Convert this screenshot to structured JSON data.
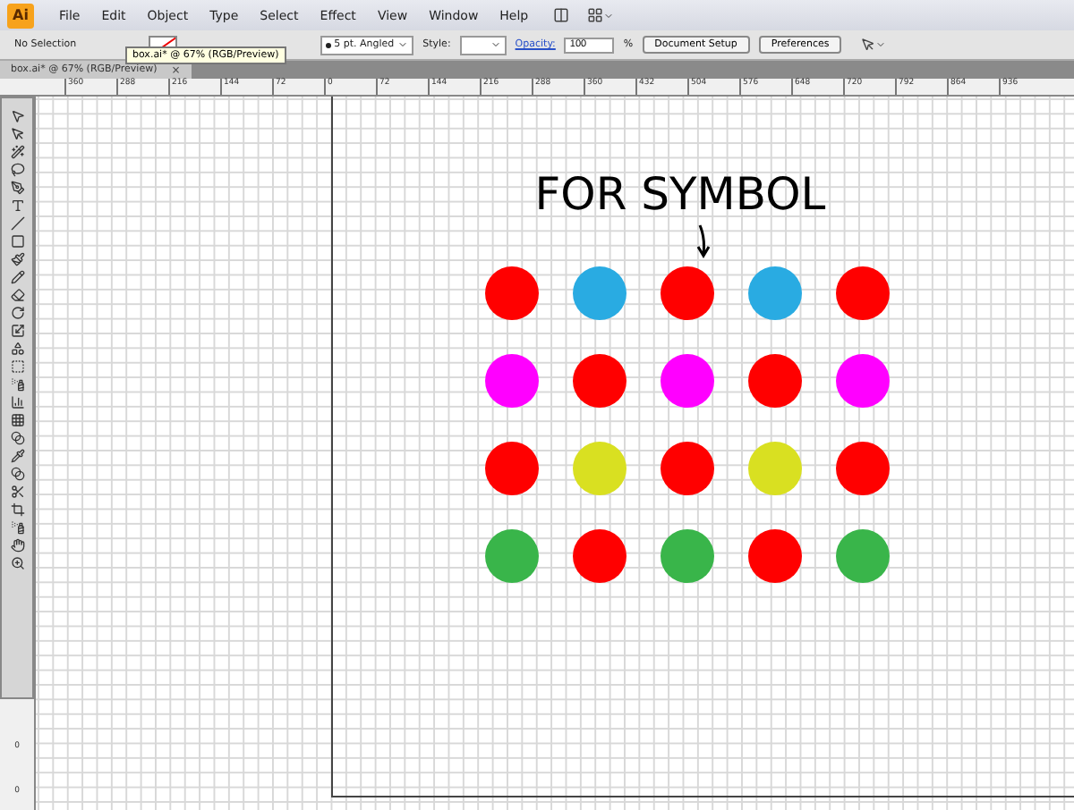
{
  "app": {
    "logo": "Ai"
  },
  "menu": [
    "File",
    "Edit",
    "Object",
    "Type",
    "Select",
    "Effect",
    "View",
    "Window",
    "Help"
  ],
  "control_bar": {
    "selection": "No Selection",
    "brush": "5 pt. Angled",
    "style_label": "Style:",
    "opacity_label": "Opacity:",
    "opacity": "100",
    "opacity_unit": "%",
    "buttons": [
      "Document Setup",
      "Preferences"
    ]
  },
  "tooltip": "box.ai* @ 67% (RGB/Preview)",
  "tab": {
    "title": "box.ai* @ 67% (RGB/Preview)",
    "close": "×"
  },
  "ruler": [
    "360",
    "288",
    "216",
    "144",
    "72",
    "0",
    "72",
    "144",
    "216",
    "288",
    "360",
    "432",
    "504",
    "576",
    "648",
    "720",
    "792",
    "864",
    "936"
  ],
  "vertical_ruler": [
    "0",
    "0"
  ],
  "artboard": {
    "heading": "FOR SYMBOL",
    "dot_rows": [
      [
        {
          "color": "#ff0000"
        },
        {
          "color": "#29abe2"
        },
        {
          "color": "#ff0000"
        },
        {
          "color": "#29abe2"
        },
        {
          "color": "#ff0000"
        }
      ],
      [
        {
          "color": "#ff00ff"
        },
        {
          "color": "#ff0000"
        },
        {
          "color": "#ff00ff"
        },
        {
          "color": "#ff0000"
        },
        {
          "color": "#ff00ff"
        }
      ],
      [
        {
          "color": "#ff0000"
        },
        {
          "color": "#d9e021"
        },
        {
          "color": "#ff0000"
        },
        {
          "color": "#d9e021"
        },
        {
          "color": "#ff0000"
        }
      ],
      [
        {
          "color": "#39b54a"
        },
        {
          "color": "#ff0000"
        },
        {
          "color": "#39b54a"
        },
        {
          "color": "#ff0000"
        },
        {
          "color": "#39b54a"
        }
      ]
    ]
  }
}
